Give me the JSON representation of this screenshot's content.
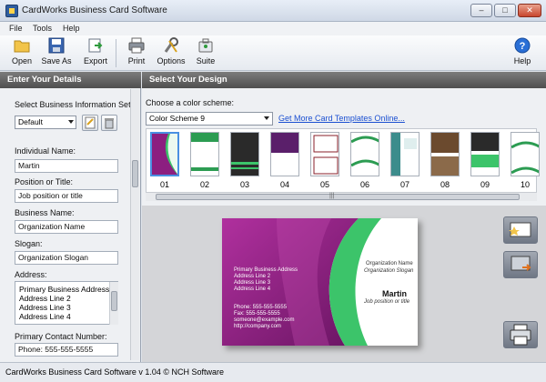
{
  "window": {
    "title": "CardWorks Business Card Software",
    "min_glyph": "–",
    "max_glyph": "□",
    "close_glyph": "✕"
  },
  "menu": [
    "File",
    "Tools",
    "Help"
  ],
  "toolbar": {
    "open": "Open",
    "save_as": "Save As",
    "export": "Export",
    "print": "Print",
    "options": "Options",
    "suite": "Suite",
    "help": "Help"
  },
  "left": {
    "header": "Enter Your Details",
    "info_set_label": "Select Business Information Set",
    "info_set_value": "Default",
    "fields": [
      {
        "label": "Individual Name:",
        "value": "Martin"
      },
      {
        "label": "Position or Title:",
        "value": "Job position or title"
      },
      {
        "label": "Business Name:",
        "value": "Organization Name"
      },
      {
        "label": "Slogan:",
        "value": "Organization Slogan"
      }
    ],
    "address_label": "Address:",
    "address_lines": [
      "Primary Business Address",
      "Address Line 2",
      "Address Line 3",
      "Address Line 4"
    ],
    "contact_label": "Primary Contact Number:",
    "contact_value": "Phone: 555-555-5555"
  },
  "right": {
    "header": "Select Your Design",
    "scheme_label": "Choose a color scheme:",
    "scheme_value": "Color Scheme 9",
    "more_link": "Get More Card Templates Online...",
    "thumb_numbers": [
      "01",
      "02",
      "03",
      "04",
      "05",
      "06",
      "07",
      "08",
      "09",
      "10"
    ],
    "scroll_glyph": "|||"
  },
  "card": {
    "org_name": "Organization Name",
    "org_slogan": "Organization Slogan",
    "name": "Martin",
    "title": "Job position or title",
    "address": [
      "Primary Business Address",
      "Address Line 2",
      "Address Line 3",
      "Address Line 4"
    ],
    "contact": [
      "Phone: 555-555-5555",
      "Fax: 555-555-5555",
      "someone@example.com",
      "http://company.com"
    ]
  },
  "status": "CardWorks Business Card Software v 1.04 © NCH Software",
  "colors": {
    "magenta": "#8c1f80",
    "green": "#3cc46a",
    "link": "#1a4fd1"
  }
}
